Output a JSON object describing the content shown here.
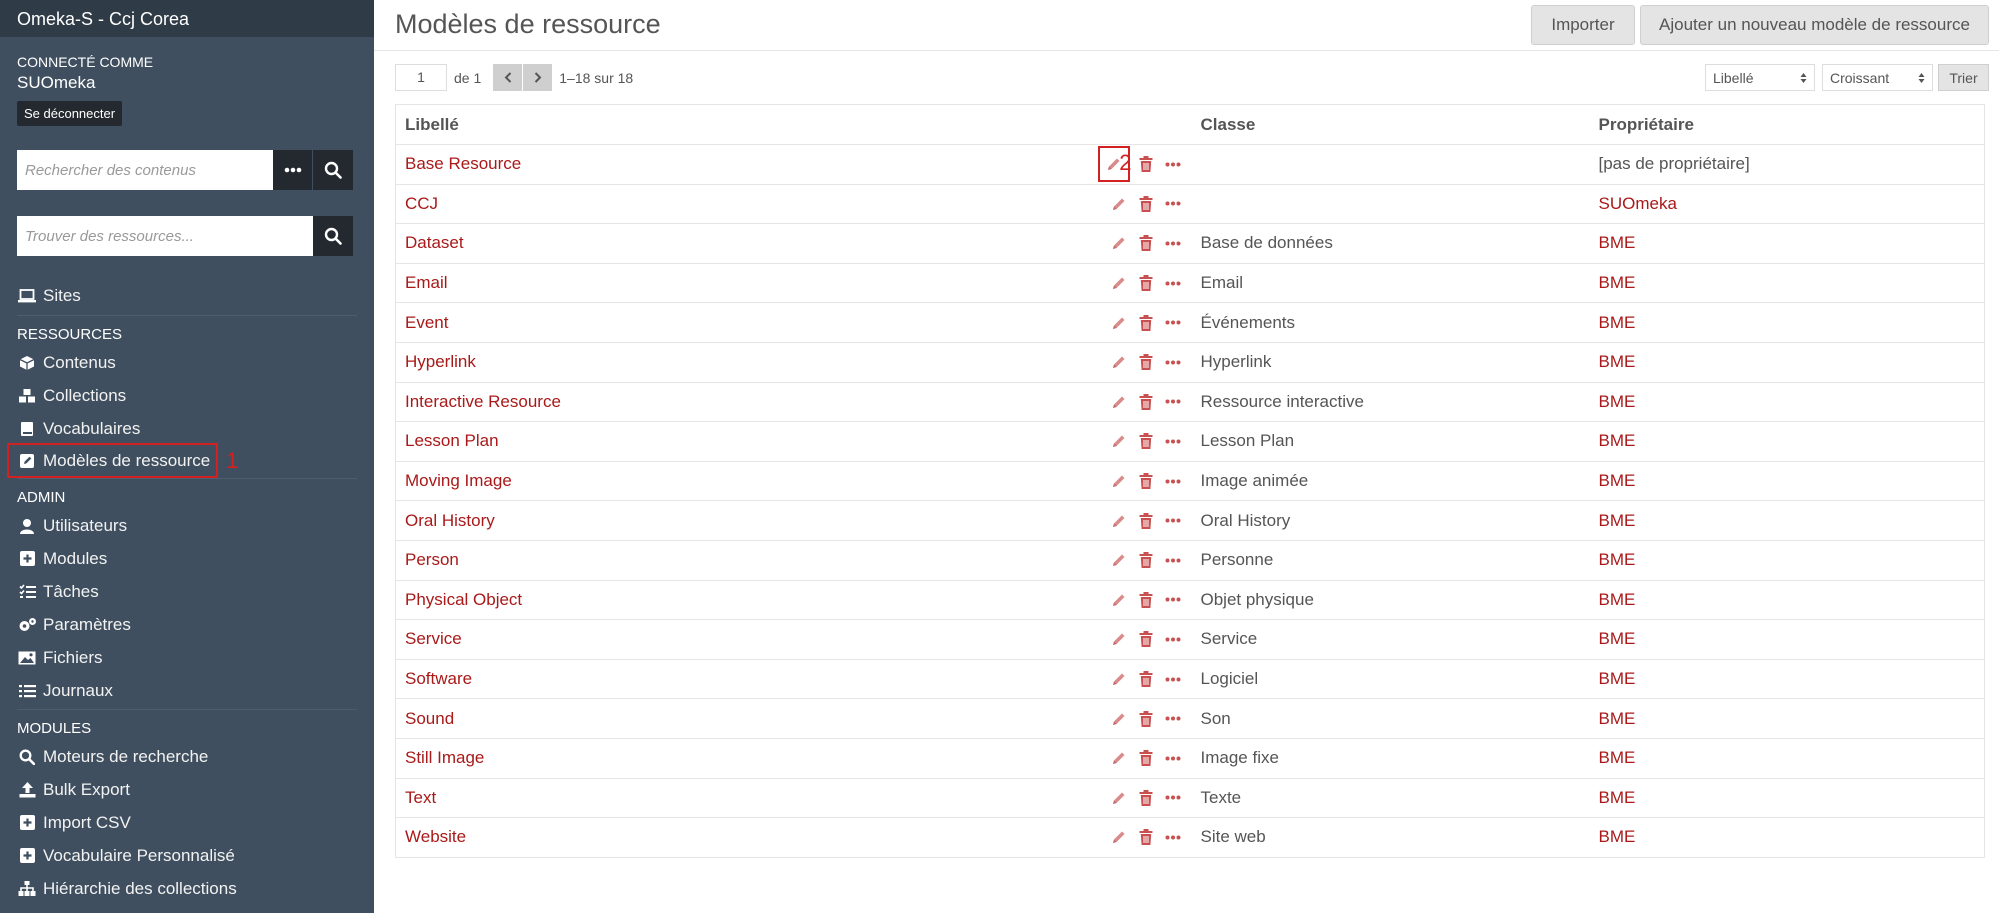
{
  "app_title": "Omeka-S - Ccj Corea",
  "user": {
    "caption": "Connecté comme",
    "name": "SUOmeka",
    "logout_label": "Se déconnecter"
  },
  "search": {
    "placeholder": "Rechercher des contenus"
  },
  "resource_search": {
    "placeholder": "Trouver des ressources..."
  },
  "nav": {
    "sites": "Sites",
    "section_resources": "Ressources",
    "resources": [
      "Contenus",
      "Collections",
      "Vocabulaires",
      "Modèles de ressource"
    ],
    "section_admin": "Admin",
    "admin": [
      "Utilisateurs",
      "Modules",
      "Tâches",
      "Paramètres",
      "Fichiers",
      "Journaux"
    ],
    "section_modules": "Modules",
    "modules": [
      "Moteurs de recherche",
      "Bulk Export",
      "Import CSV",
      "Vocabulaire Personnalisé",
      "Hiérarchie des collections"
    ]
  },
  "annotations": {
    "step1": "1",
    "step2": "2"
  },
  "page": {
    "title": "Modèles de ressource",
    "import_button": "Importer",
    "add_button": "Ajouter un nouveau modèle de ressource"
  },
  "pagination": {
    "current_page": "1",
    "of_label": "de 1",
    "range_label": "1–18 sur 18"
  },
  "sort": {
    "by": "Libellé",
    "order": "Croissant",
    "button": "Trier"
  },
  "table": {
    "headers": {
      "label": "Libellé",
      "class": "Classe",
      "owner": "Propriétaire"
    },
    "rows": [
      {
        "label": "Base Resource",
        "class": "",
        "owner": "[pas de propriétaire]"
      },
      {
        "label": "CCJ",
        "class": "",
        "owner": "SUOmeka"
      },
      {
        "label": "Dataset",
        "class": "Base de données",
        "owner": "BME"
      },
      {
        "label": "Email",
        "class": "Email",
        "owner": "BME"
      },
      {
        "label": "Event",
        "class": "Événements",
        "owner": "BME"
      },
      {
        "label": "Hyperlink",
        "class": "Hyperlink",
        "owner": "BME"
      },
      {
        "label": "Interactive Resource",
        "class": "Ressource interactive",
        "owner": "BME"
      },
      {
        "label": "Lesson Plan",
        "class": "Lesson Plan",
        "owner": "BME"
      },
      {
        "label": "Moving Image",
        "class": "Image animée",
        "owner": "BME"
      },
      {
        "label": "Oral History",
        "class": "Oral History",
        "owner": "BME"
      },
      {
        "label": "Person",
        "class": "Personne",
        "owner": "BME"
      },
      {
        "label": "Physical Object",
        "class": "Objet physique",
        "owner": "BME"
      },
      {
        "label": "Service",
        "class": "Service",
        "owner": "BME"
      },
      {
        "label": "Software",
        "class": "Logiciel",
        "owner": "BME"
      },
      {
        "label": "Sound",
        "class": "Son",
        "owner": "BME"
      },
      {
        "label": "Still Image",
        "class": "Image fixe",
        "owner": "BME"
      },
      {
        "label": "Text",
        "class": "Texte",
        "owner": "BME"
      },
      {
        "label": "Website",
        "class": "Site web",
        "owner": "BME"
      }
    ]
  },
  "colors": {
    "sidebar_bg": "#3f4f5f",
    "link_red": "#a91919",
    "annotation_red": "#d32020"
  }
}
